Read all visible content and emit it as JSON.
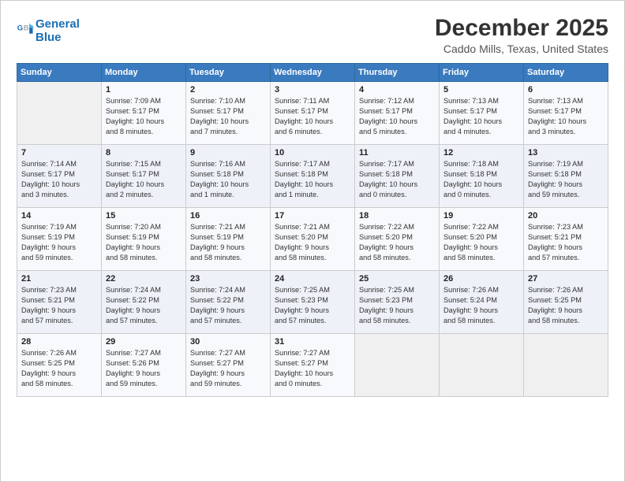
{
  "header": {
    "logo_line1": "General",
    "logo_line2": "Blue",
    "title": "December 2025",
    "subtitle": "Caddo Mills, Texas, United States"
  },
  "calendar": {
    "days_of_week": [
      "Sunday",
      "Monday",
      "Tuesday",
      "Wednesday",
      "Thursday",
      "Friday",
      "Saturday"
    ],
    "weeks": [
      [
        {
          "num": "",
          "detail": ""
        },
        {
          "num": "1",
          "detail": "Sunrise: 7:09 AM\nSunset: 5:17 PM\nDaylight: 10 hours\nand 8 minutes."
        },
        {
          "num": "2",
          "detail": "Sunrise: 7:10 AM\nSunset: 5:17 PM\nDaylight: 10 hours\nand 7 minutes."
        },
        {
          "num": "3",
          "detail": "Sunrise: 7:11 AM\nSunset: 5:17 PM\nDaylight: 10 hours\nand 6 minutes."
        },
        {
          "num": "4",
          "detail": "Sunrise: 7:12 AM\nSunset: 5:17 PM\nDaylight: 10 hours\nand 5 minutes."
        },
        {
          "num": "5",
          "detail": "Sunrise: 7:13 AM\nSunset: 5:17 PM\nDaylight: 10 hours\nand 4 minutes."
        },
        {
          "num": "6",
          "detail": "Sunrise: 7:13 AM\nSunset: 5:17 PM\nDaylight: 10 hours\nand 3 minutes."
        }
      ],
      [
        {
          "num": "7",
          "detail": "Sunrise: 7:14 AM\nSunset: 5:17 PM\nDaylight: 10 hours\nand 3 minutes."
        },
        {
          "num": "8",
          "detail": "Sunrise: 7:15 AM\nSunset: 5:17 PM\nDaylight: 10 hours\nand 2 minutes."
        },
        {
          "num": "9",
          "detail": "Sunrise: 7:16 AM\nSunset: 5:18 PM\nDaylight: 10 hours\nand 1 minute."
        },
        {
          "num": "10",
          "detail": "Sunrise: 7:17 AM\nSunset: 5:18 PM\nDaylight: 10 hours\nand 1 minute."
        },
        {
          "num": "11",
          "detail": "Sunrise: 7:17 AM\nSunset: 5:18 PM\nDaylight: 10 hours\nand 0 minutes."
        },
        {
          "num": "12",
          "detail": "Sunrise: 7:18 AM\nSunset: 5:18 PM\nDaylight: 10 hours\nand 0 minutes."
        },
        {
          "num": "13",
          "detail": "Sunrise: 7:19 AM\nSunset: 5:18 PM\nDaylight: 9 hours\nand 59 minutes."
        }
      ],
      [
        {
          "num": "14",
          "detail": "Sunrise: 7:19 AM\nSunset: 5:19 PM\nDaylight: 9 hours\nand 59 minutes."
        },
        {
          "num": "15",
          "detail": "Sunrise: 7:20 AM\nSunset: 5:19 PM\nDaylight: 9 hours\nand 58 minutes."
        },
        {
          "num": "16",
          "detail": "Sunrise: 7:21 AM\nSunset: 5:19 PM\nDaylight: 9 hours\nand 58 minutes."
        },
        {
          "num": "17",
          "detail": "Sunrise: 7:21 AM\nSunset: 5:20 PM\nDaylight: 9 hours\nand 58 minutes."
        },
        {
          "num": "18",
          "detail": "Sunrise: 7:22 AM\nSunset: 5:20 PM\nDaylight: 9 hours\nand 58 minutes."
        },
        {
          "num": "19",
          "detail": "Sunrise: 7:22 AM\nSunset: 5:20 PM\nDaylight: 9 hours\nand 58 minutes."
        },
        {
          "num": "20",
          "detail": "Sunrise: 7:23 AM\nSunset: 5:21 PM\nDaylight: 9 hours\nand 57 minutes."
        }
      ],
      [
        {
          "num": "21",
          "detail": "Sunrise: 7:23 AM\nSunset: 5:21 PM\nDaylight: 9 hours\nand 57 minutes."
        },
        {
          "num": "22",
          "detail": "Sunrise: 7:24 AM\nSunset: 5:22 PM\nDaylight: 9 hours\nand 57 minutes."
        },
        {
          "num": "23",
          "detail": "Sunrise: 7:24 AM\nSunset: 5:22 PM\nDaylight: 9 hours\nand 57 minutes."
        },
        {
          "num": "24",
          "detail": "Sunrise: 7:25 AM\nSunset: 5:23 PM\nDaylight: 9 hours\nand 57 minutes."
        },
        {
          "num": "25",
          "detail": "Sunrise: 7:25 AM\nSunset: 5:23 PM\nDaylight: 9 hours\nand 58 minutes."
        },
        {
          "num": "26",
          "detail": "Sunrise: 7:26 AM\nSunset: 5:24 PM\nDaylight: 9 hours\nand 58 minutes."
        },
        {
          "num": "27",
          "detail": "Sunrise: 7:26 AM\nSunset: 5:25 PM\nDaylight: 9 hours\nand 58 minutes."
        }
      ],
      [
        {
          "num": "28",
          "detail": "Sunrise: 7:26 AM\nSunset: 5:25 PM\nDaylight: 9 hours\nand 58 minutes."
        },
        {
          "num": "29",
          "detail": "Sunrise: 7:27 AM\nSunset: 5:26 PM\nDaylight: 9 hours\nand 59 minutes."
        },
        {
          "num": "30",
          "detail": "Sunrise: 7:27 AM\nSunset: 5:27 PM\nDaylight: 9 hours\nand 59 minutes."
        },
        {
          "num": "31",
          "detail": "Sunrise: 7:27 AM\nSunset: 5:27 PM\nDaylight: 10 hours\nand 0 minutes."
        },
        {
          "num": "",
          "detail": ""
        },
        {
          "num": "",
          "detail": ""
        },
        {
          "num": "",
          "detail": ""
        }
      ]
    ]
  }
}
